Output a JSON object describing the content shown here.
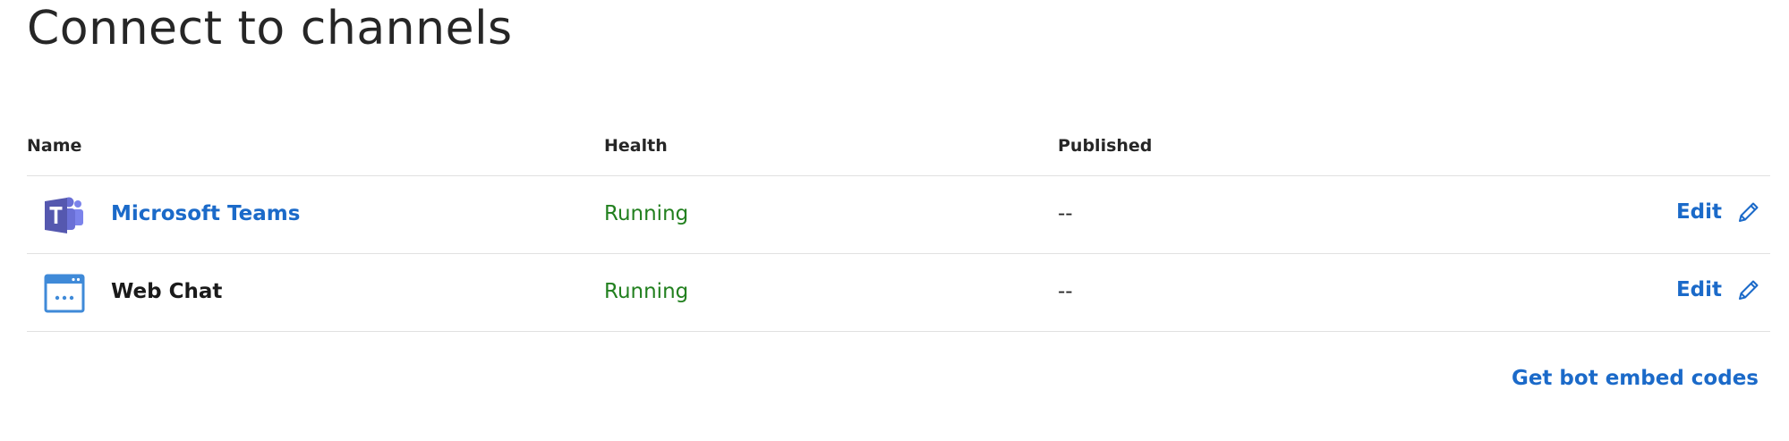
{
  "page": {
    "title": "Connect to channels"
  },
  "table": {
    "columns": {
      "name": "Name",
      "health": "Health",
      "published": "Published"
    },
    "rows": [
      {
        "name": "Microsoft Teams",
        "icon": "microsoft-teams-icon",
        "health": "Running",
        "published": "--",
        "edit_label": "Edit"
      },
      {
        "name": "Web Chat",
        "icon": "web-chat-icon",
        "health": "Running",
        "published": "--",
        "edit_label": "Edit"
      }
    ]
  },
  "footer": {
    "embed_link": "Get bot embed codes"
  },
  "colors": {
    "link": "#1b6ac9",
    "running": "#22801f",
    "teams_brand": "#5558af",
    "divider": "#e1e1e1"
  }
}
